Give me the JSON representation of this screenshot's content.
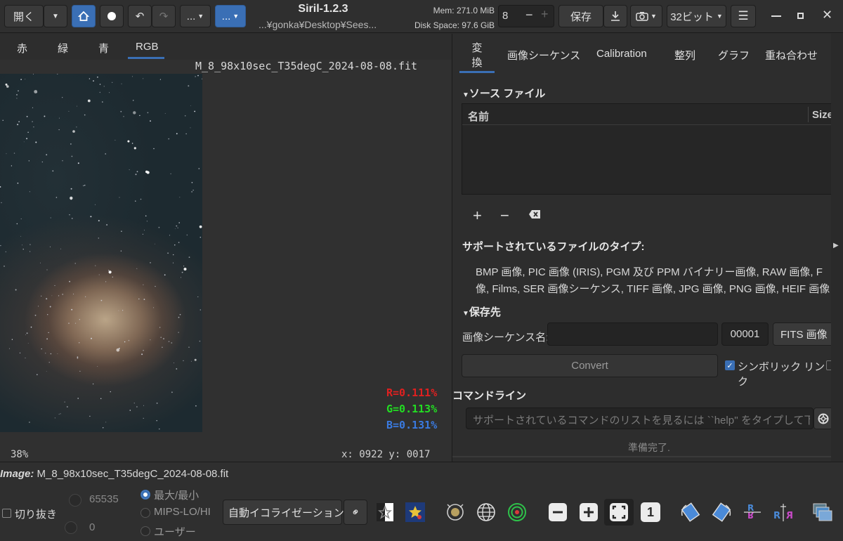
{
  "header": {
    "open_label": "開く",
    "app_title": "Siril-1.2.3",
    "path": "...¥gonka¥Desktop¥Sees...",
    "mem": "Mem: 271.0 MiB",
    "disk": "Disk Space: 97.6 GiB",
    "stepper_value": "8",
    "stepper_minus": "−",
    "stepper_plus": "+",
    "save_label": "保存",
    "bit_depth": "32ビット",
    "script_menu_label": "...",
    "process_menu_label": "..."
  },
  "viewer": {
    "channel_tabs": [
      "赤",
      "緑",
      "青",
      "RGB"
    ],
    "filename": "M_8_98x10sec_T35degC_2024-08-08.fit",
    "r_value": "R=0.111%",
    "g_value": "G=0.113%",
    "b_value": "B=0.131%",
    "zoom": "38%",
    "coords": "x: 0922 y: 0017"
  },
  "panel": {
    "tabs": [
      "変換",
      "画像シーケンス",
      "Calibration",
      "整列",
      "グラフ",
      "重ね合わせ"
    ],
    "source_title": "ソース ファイル",
    "col_name": "名前",
    "col_size": "Size",
    "supported_title": "サポートされているファイルのタイプ:",
    "supported_line1": "BMP 画像, PIC 画像 (IRIS), PGM 及び PPM バイナリー画像, RAW 画像, F",
    "supported_line2": "像, Films, SER 画像シーケンス, TIFF 画像, JPG 画像, PNG 画像, HEIF 画像",
    "dest_title": "保存先",
    "seq_name_label": "画像シーケンス名:",
    "seq_name_value": "",
    "start_index": "00001",
    "output_format": "FITS 画像",
    "convert_label": "Convert",
    "symlink_label": "シンボリック リンク",
    "cmd_title": "コマンドライン",
    "cmd_placeholder": "サポートされているコマンドのリストを見るには ``help'' をタイプして下さい",
    "status": "準備完了."
  },
  "bottom": {
    "image_label": "Image:",
    "image_name": "M_8_98x10sec_T35degC_2024-08-08.fit",
    "crop_label": "切り抜き",
    "hi_value": "65535",
    "lo_value": "0",
    "mode_minmax": "最大/最小",
    "mode_mips": "MIPS-LO/HI",
    "mode_user": "ユーザー",
    "stretch_select": "自動イコライゼーション",
    "one_to_one": "1"
  },
  "colors": {
    "accent_blue": "#3a6fb5",
    "r_text": "#e02020",
    "g_text": "#22dd22",
    "b_text": "#3a7ae0"
  }
}
